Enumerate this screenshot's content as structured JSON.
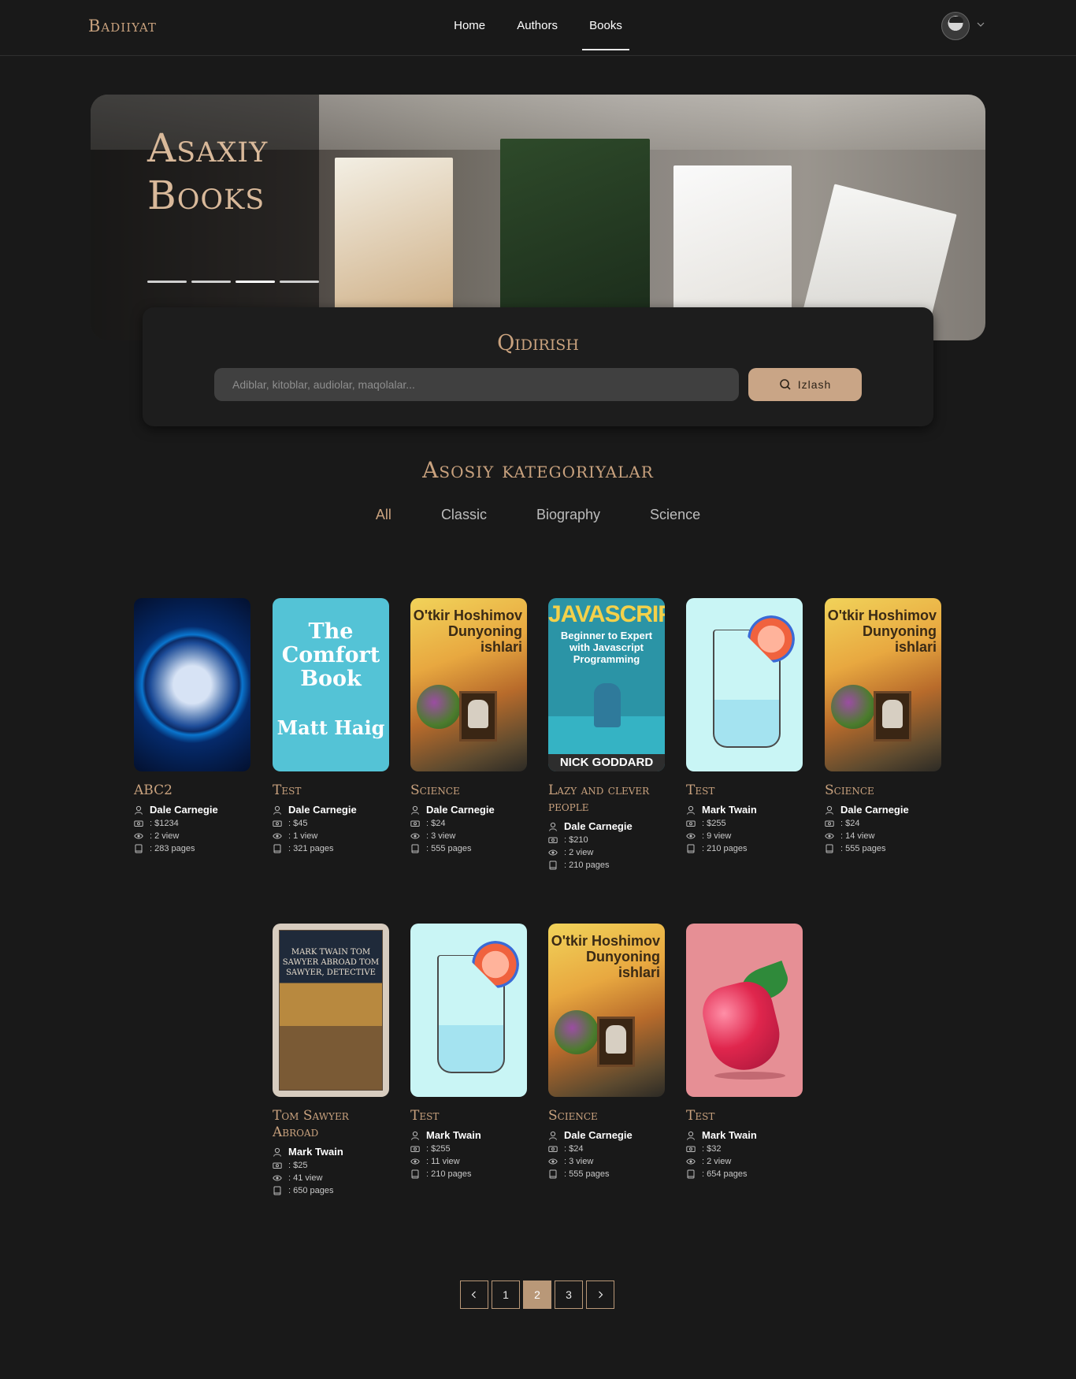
{
  "brand": {
    "logo": "Badiiyat",
    "accent": "#c9a27e"
  },
  "nav": {
    "items": [
      "Home",
      "Authors",
      "Books"
    ],
    "active": "Books"
  },
  "user": {
    "avatar_icon": "user-avatar",
    "menu_icon": "chevron-down-icon"
  },
  "hero": {
    "title_line1": "Asaxiy",
    "title_line2": "Books",
    "slides_total": 4,
    "active_slide": 3
  },
  "search": {
    "title": "Qidirish",
    "placeholder": "Adiblar, kitoblar, audiolar, maqolalar...",
    "button_label": "Izlash",
    "button_icon": "search-icon"
  },
  "categories": {
    "title": "Asosiy kategoriyalar",
    "items": [
      "All",
      "Classic",
      "Biography",
      "Science"
    ],
    "active": "All"
  },
  "books": [
    {
      "title": "ABC2",
      "author": "Dale Carnegie",
      "price": ": $1234",
      "views": ": 2 view",
      "pages": ": 283 pages",
      "cover": "moon"
    },
    {
      "title": "Test",
      "author": "Dale Carnegie",
      "price": ": $45",
      "views": ": 1 view",
      "pages": ": 321 pages",
      "cover": "comfort-book"
    },
    {
      "title": "Science",
      "author": "Dale Carnegie",
      "price": ": $24",
      "views": ": 3 view",
      "pages": ": 555 pages",
      "cover": "dunyoning-ishlari"
    },
    {
      "title": "Lazy and clever people",
      "author": "Dale Carnegie",
      "price": ": $210",
      "views": ": 2 view",
      "pages": ": 210 pages",
      "cover": "javascript"
    },
    {
      "title": "Test",
      "author": "Mark Twain",
      "price": ": $255",
      "views": ": 9 view",
      "pages": ": 210 pages",
      "cover": "glass"
    },
    {
      "title": "Science",
      "author": "Dale Carnegie",
      "price": ": $24",
      "views": ": 14 view",
      "pages": ": 555 pages",
      "cover": "dunyoning-ishlari"
    },
    {
      "title": "Tom Sawyer Abroad",
      "author": "Mark Twain",
      "price": ": $25",
      "views": ": 41 view",
      "pages": ": 650 pages",
      "cover": "tom-sawyer"
    },
    {
      "title": "Test",
      "author": "Mark Twain",
      "price": ": $255",
      "views": ": 11 view",
      "pages": ": 210 pages",
      "cover": "glass"
    },
    {
      "title": "Science",
      "author": "Dale Carnegie",
      "price": ": $24",
      "views": ": 3 view",
      "pages": ": 555 pages",
      "cover": "dunyoning-ishlari"
    },
    {
      "title": "Test",
      "author": "Mark Twain",
      "price": ": $32",
      "views": ": 2 view",
      "pages": ": 654 pages",
      "cover": "raspberry"
    }
  ],
  "covers": {
    "comfort": {
      "title": "The Comfort Book",
      "author": "Matt Haig"
    },
    "dung": {
      "title": "O'tkir Hoshimov Dunyoning ishlari"
    },
    "js": {
      "title": "JAVASCRIPT",
      "subtitle": "Beginner to Expert with Javascript Programming",
      "author": "NICK GODDARD"
    },
    "tom": {
      "title": "MARK TWAIN TOM SAWYER ABROAD TOM SAWYER, DETECTIVE"
    }
  },
  "pagination": {
    "prev_icon": "chevron-left-icon",
    "next_icon": "chevron-right-icon",
    "pages": [
      "1",
      "2",
      "3"
    ],
    "current": "2"
  }
}
